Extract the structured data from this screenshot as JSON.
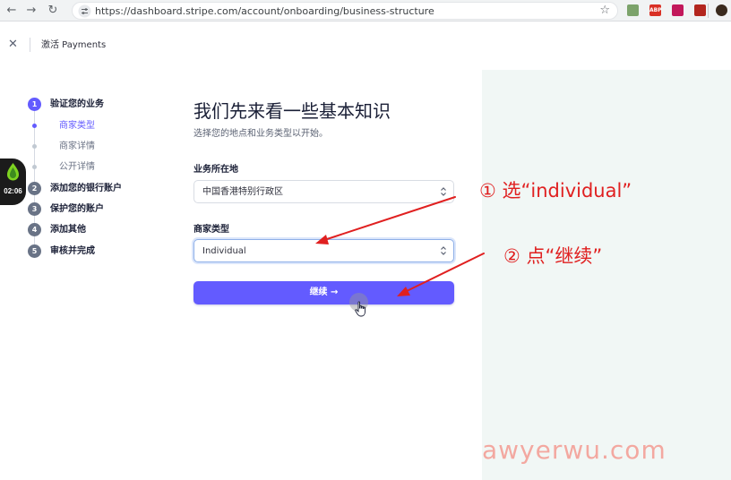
{
  "browser": {
    "url": "https://dashboard.stripe.com/account/onboarding/business-structure",
    "extensions": [
      "photo-extension",
      "abp-extension",
      "puzzle-extension",
      "tab-extension",
      "profile-avatar"
    ],
    "extension_labels": {
      "abp": "ABP"
    }
  },
  "header": {
    "title": "激活 Payments"
  },
  "stepper": {
    "steps": [
      {
        "number": "1",
        "label": "验证您的业务"
      },
      {
        "number": "2",
        "label": "添加您的银行账户"
      },
      {
        "number": "3",
        "label": "保护您的账户"
      },
      {
        "number": "4",
        "label": "添加其他"
      },
      {
        "number": "5",
        "label": "审核并完成"
      }
    ],
    "substeps": [
      {
        "label": "商家类型"
      },
      {
        "label": "商家详情"
      },
      {
        "label": "公开详情"
      }
    ]
  },
  "timer": {
    "text": "02:06"
  },
  "form": {
    "heading": "我们先来看一些基本知识",
    "subtitle": "选择您的地点和业务类型以开始。",
    "location_label": "业务所在地",
    "location_value": "中国香港特别行政区",
    "business_type_label": "商家类型",
    "business_type_value": "Individual",
    "continue_label": "继续 →"
  },
  "annotations": {
    "step1": "① 选“individual”",
    "step2": "② 点“继续”"
  },
  "watermark": "awyerwu.com",
  "colors": {
    "accent": "#635bff",
    "annotation": "#e02020",
    "mint_panel": "#f1f7f5",
    "watermark": "#f3a8a0"
  }
}
